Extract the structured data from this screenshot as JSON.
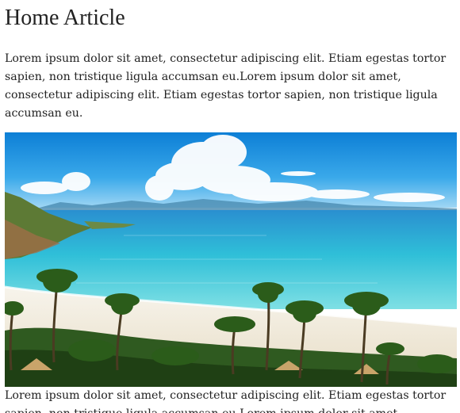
{
  "article": {
    "title": "Home Article",
    "intro": "Lorem ipsum dolor sit amet, consectetur adipiscing elit. Etiam egestas tortor sapien, non tristique ligula accumsan eu.Lorem ipsum dolor sit amet, consectetur adipiscing elit. Etiam egestas tortor sapien, non tristique ligula accumsan eu.",
    "body": "Lorem ipsum dolor sit amet, consectetur adipiscing elit. Etiam egestas tortor sapien, non tristique ligula accumsan eu.Lorem ipsum dolor sit amet,"
  },
  "image": {
    "subject": "tropical-beach-with-palm-trees",
    "colors": {
      "sky": "#1a9ee6",
      "sea": "#2fc3d8",
      "sand": "#f1ece0",
      "palm": "#2d4a1e"
    }
  }
}
